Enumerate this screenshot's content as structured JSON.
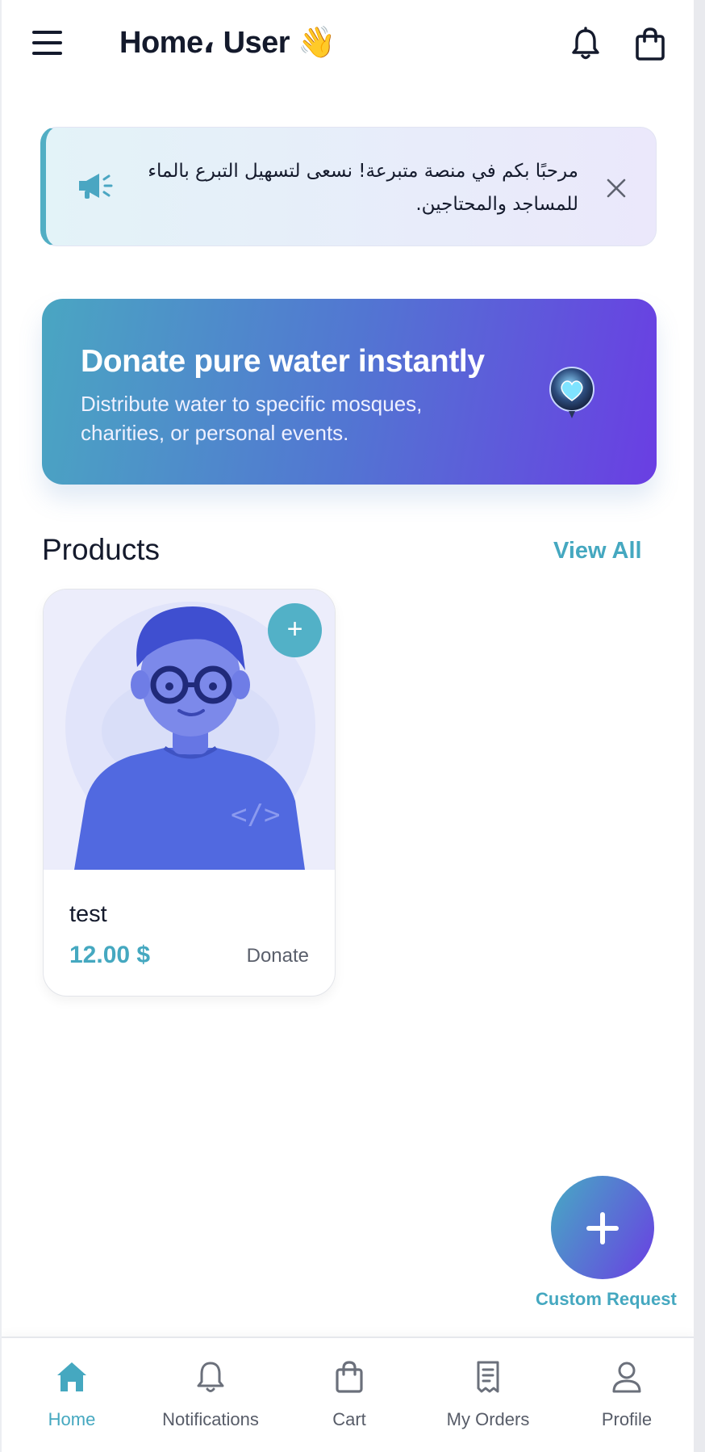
{
  "header": {
    "title": "Home، User 👋",
    "menu_icon": "hamburger-menu-icon",
    "notification_icon": "bell-icon",
    "cart_icon": "shopping-bag-icon"
  },
  "announcement": {
    "text": "مرحبًا بكم في منصة متبرعة! نسعى لتسهيل التبرع بالماء للمساجد والمحتاجين.",
    "icon": "megaphone-icon",
    "close_icon": "close-icon"
  },
  "banner": {
    "title": "Donate pure water instantly",
    "subtitle": "Distribute water to specific mosques, charities, or personal events.",
    "icon": "heart-balloon-icon"
  },
  "products": {
    "title": "Products",
    "view_all": "View All",
    "items": [
      {
        "name": "test",
        "price": "12.00 $",
        "action": "Donate",
        "add_label": "+",
        "image": "developer-avatar-illustration"
      }
    ]
  },
  "fab": {
    "label": "Custom Request",
    "icon": "plus-icon"
  },
  "bottom_nav": {
    "items": [
      {
        "label": "Home",
        "icon": "home-icon",
        "active": true
      },
      {
        "label": "Notifications",
        "icon": "bell-icon",
        "active": false
      },
      {
        "label": "Cart",
        "icon": "shopping-bag-icon",
        "active": false
      },
      {
        "label": "My Orders",
        "icon": "receipt-icon",
        "active": false
      },
      {
        "label": "Profile",
        "icon": "user-icon",
        "active": false
      }
    ]
  },
  "colors": {
    "accent": "#45a8c0",
    "gradient_start": "#4aa6c2",
    "gradient_end": "#6a3ee3",
    "text_dark": "#141a2c"
  }
}
